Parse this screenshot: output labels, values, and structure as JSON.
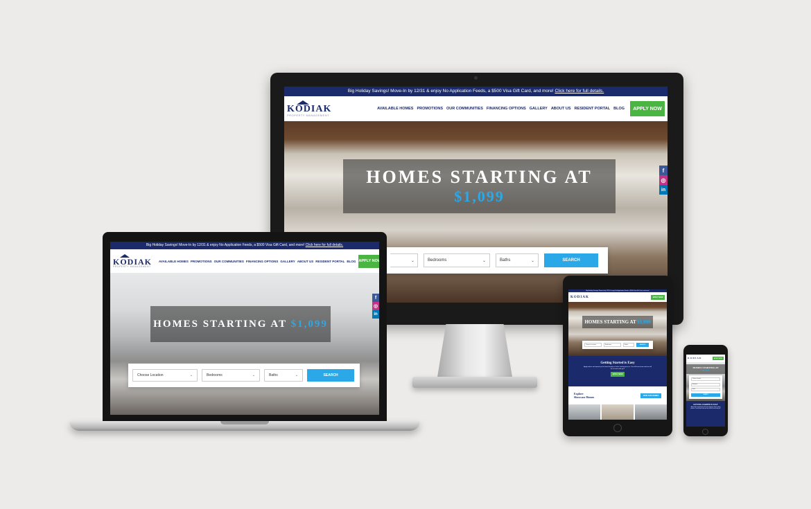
{
  "banner": {
    "text": "Big Holiday Savings! Move-In by 12/31 & enjoy No Application Feeds, a $500 Visa Gift Card, and more!",
    "link": "Click here for full details."
  },
  "logo": {
    "name": "KODIAK",
    "sub": "PROPERTY MANAGEMENT"
  },
  "nav": [
    "AVAILABLE HOMES",
    "PROMOTIONS",
    "OUR COMMUNITIES",
    "FINANCING OPTIONS",
    "GALLERY",
    "ABOUT US",
    "RESIDENT PORTAL",
    "BLOG"
  ],
  "apply": "APPLY NOW",
  "hero": {
    "title": "HOMES STARTING AT",
    "price": "$1,099"
  },
  "search": {
    "location": "Choose Location",
    "bedrooms": "Bedrooms",
    "baths": "Baths",
    "button": "SEARCH"
  },
  "social": {
    "facebook": "f",
    "instagram": "◎",
    "linkedin": "in"
  },
  "tablet": {
    "getting_started": "Getting Started is Easy",
    "getting_text": "Apply online and speed up the home buying or home renting process. You will even know and we will be in touch with you!",
    "explore": "Explore",
    "showcase": "Showcase Homes",
    "view_btn": "VIEW OUR HOMES"
  },
  "phone": {
    "getting_started": "GETTING STARTED IS EASY"
  },
  "colors": {
    "navy": "#1b2a6b",
    "green": "#4bb543",
    "blue": "#2aa8e8",
    "background": "#ecebe9"
  }
}
